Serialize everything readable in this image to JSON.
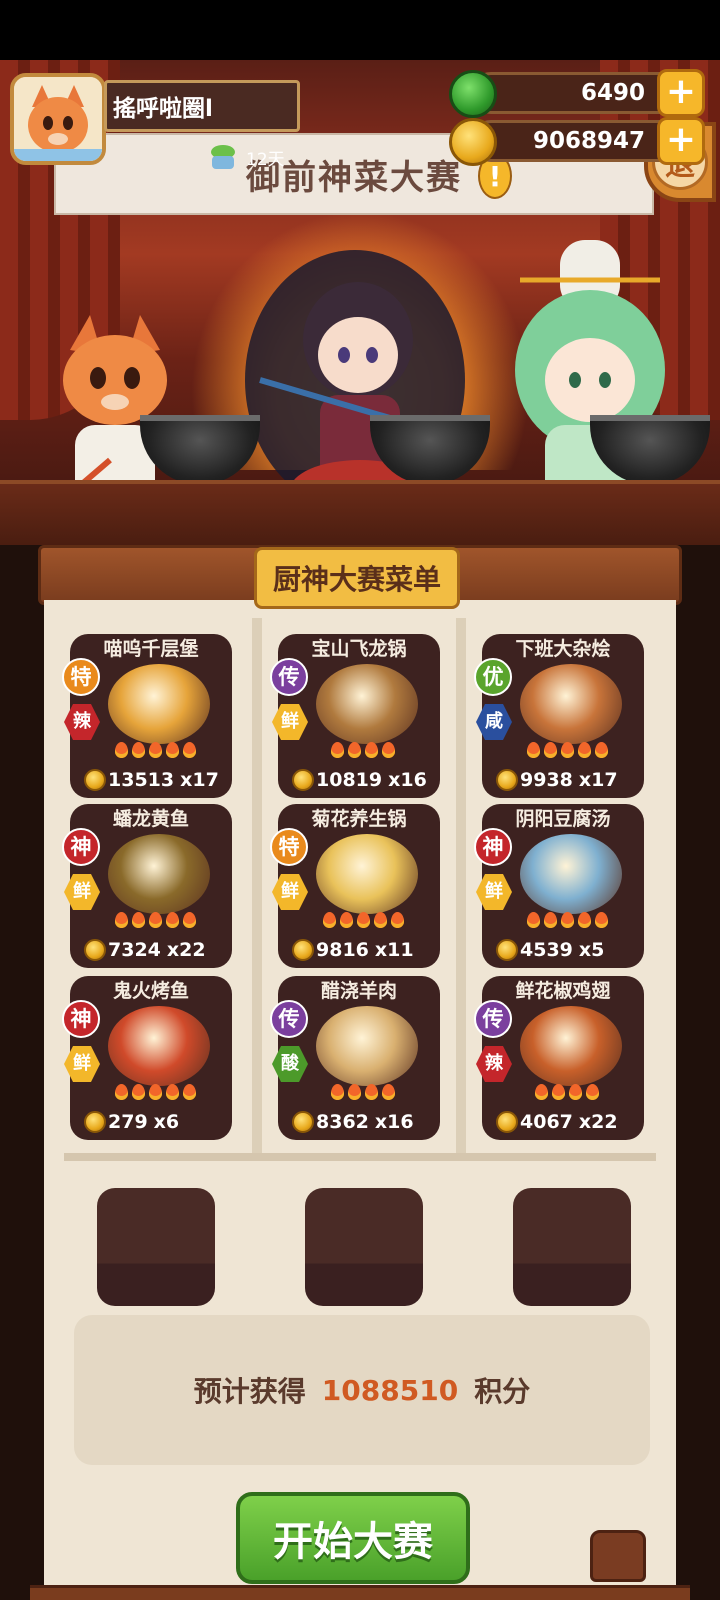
{
  "player": {
    "name": "搖呼啦圈l",
    "days": "12天"
  },
  "currency": {
    "jade": "6490",
    "coins": "9068947"
  },
  "banner": {
    "title": "御前神菜大赛",
    "exit_label": "退"
  },
  "menu": {
    "tab_title": "厨神大赛菜单",
    "dishes": [
      {
        "name": "喵呜千层堡",
        "grade": "特",
        "flavor": "辣",
        "price": "13513",
        "qty": "x17",
        "flames": 5
      },
      {
        "name": "宝山飞龙锅",
        "grade": "传",
        "flavor": "鲜",
        "price": "10819",
        "qty": "x16",
        "flames": 4
      },
      {
        "name": "下班大杂烩",
        "grade": "优",
        "flavor": "咸",
        "price": "9938",
        "qty": "x17",
        "flames": 5
      },
      {
        "name": "蟠龙黄鱼",
        "grade": "神",
        "flavor": "鲜",
        "price": "7324",
        "qty": "x22",
        "flames": 5
      },
      {
        "name": "菊花养生锅",
        "grade": "特",
        "flavor": "鲜",
        "price": "9816",
        "qty": "x11",
        "flames": 5
      },
      {
        "name": "阴阳豆腐汤",
        "grade": "神",
        "flavor": "鲜",
        "price": "4539",
        "qty": "x5",
        "flames": 5
      },
      {
        "name": "鬼火烤鱼",
        "grade": "神",
        "flavor": "鲜",
        "price": "279",
        "qty": "x6",
        "flames": 5
      },
      {
        "name": "醋浇羊肉",
        "grade": "传",
        "flavor": "酸",
        "price": "8362",
        "qty": "x16",
        "flames": 4
      },
      {
        "name": "鲜花椒鸡翅",
        "grade": "传",
        "flavor": "辣",
        "price": "4067",
        "qty": "x22",
        "flames": 4
      }
    ]
  },
  "estimate": {
    "label": "预计获得",
    "value": "1088510",
    "unit": "积分"
  },
  "start_button": "开始大赛",
  "colors": {
    "grade_特": "#e98a1c",
    "grade_传": "#7b3f9e",
    "grade_优": "#5aa42c",
    "grade_神": "#c4262b",
    "flavor_辣": "#c4262b",
    "flavor_鲜": "#f3b72a",
    "flavor_咸": "#2a4f9e",
    "flavor_酸": "#4c9a2a",
    "dish_colors": [
      "#e6a43a",
      "#b07a3e",
      "#c8743a",
      "#8a6a2a",
      "#e9c25a",
      "#7fb0d0",
      "#d04a2a",
      "#d9b070",
      "#c8602a"
    ]
  }
}
